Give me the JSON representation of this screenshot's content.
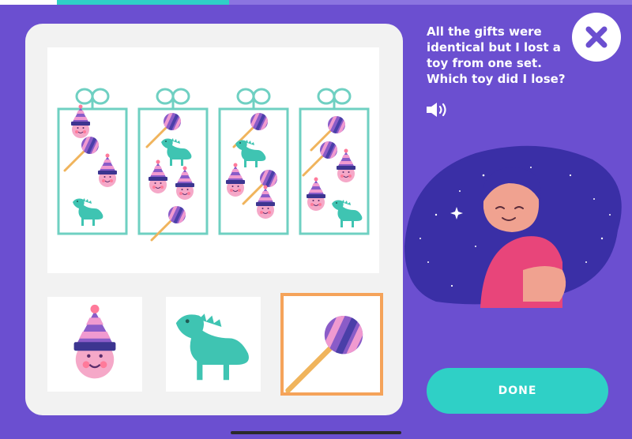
{
  "progress": {
    "fraction": 0.36
  },
  "question": {
    "text": "All the gifts were identical but I lost a toy from one set. Which toy did I lose?"
  },
  "buttons": {
    "done_label": "DONE"
  },
  "icons": {
    "close": "close-icon",
    "speaker": "speaker-icon",
    "gift": "gift-box-icon",
    "party_boy": "party-hat-face-icon",
    "dinosaur": "dinosaur-icon",
    "lollipop": "lollipop-icon"
  },
  "gifts": [
    {
      "contents": [
        "party-hat-face",
        "lollipop",
        "party-hat-face",
        "dinosaur"
      ]
    },
    {
      "contents": [
        "lollipop",
        "dinosaur",
        "party-hat-face",
        "party-hat-face",
        "lollipop"
      ]
    },
    {
      "contents": [
        "lollipop",
        "dinosaur",
        "party-hat-face",
        "party-hat-face",
        "lollipop"
      ]
    },
    {
      "contents": [
        "lollipop",
        "lollipop",
        "party-hat-face",
        "party-hat-face",
        "dinosaur"
      ]
    }
  ],
  "choices": [
    {
      "item": "party-hat-face",
      "selected": false
    },
    {
      "item": "dinosaur",
      "selected": false
    },
    {
      "item": "lollipop",
      "selected": true
    }
  ],
  "colors": {
    "background": "#6b4fd0",
    "accent": "#2fd0c6",
    "selection": "#f5a35a",
    "card": "#f2f2f2"
  }
}
